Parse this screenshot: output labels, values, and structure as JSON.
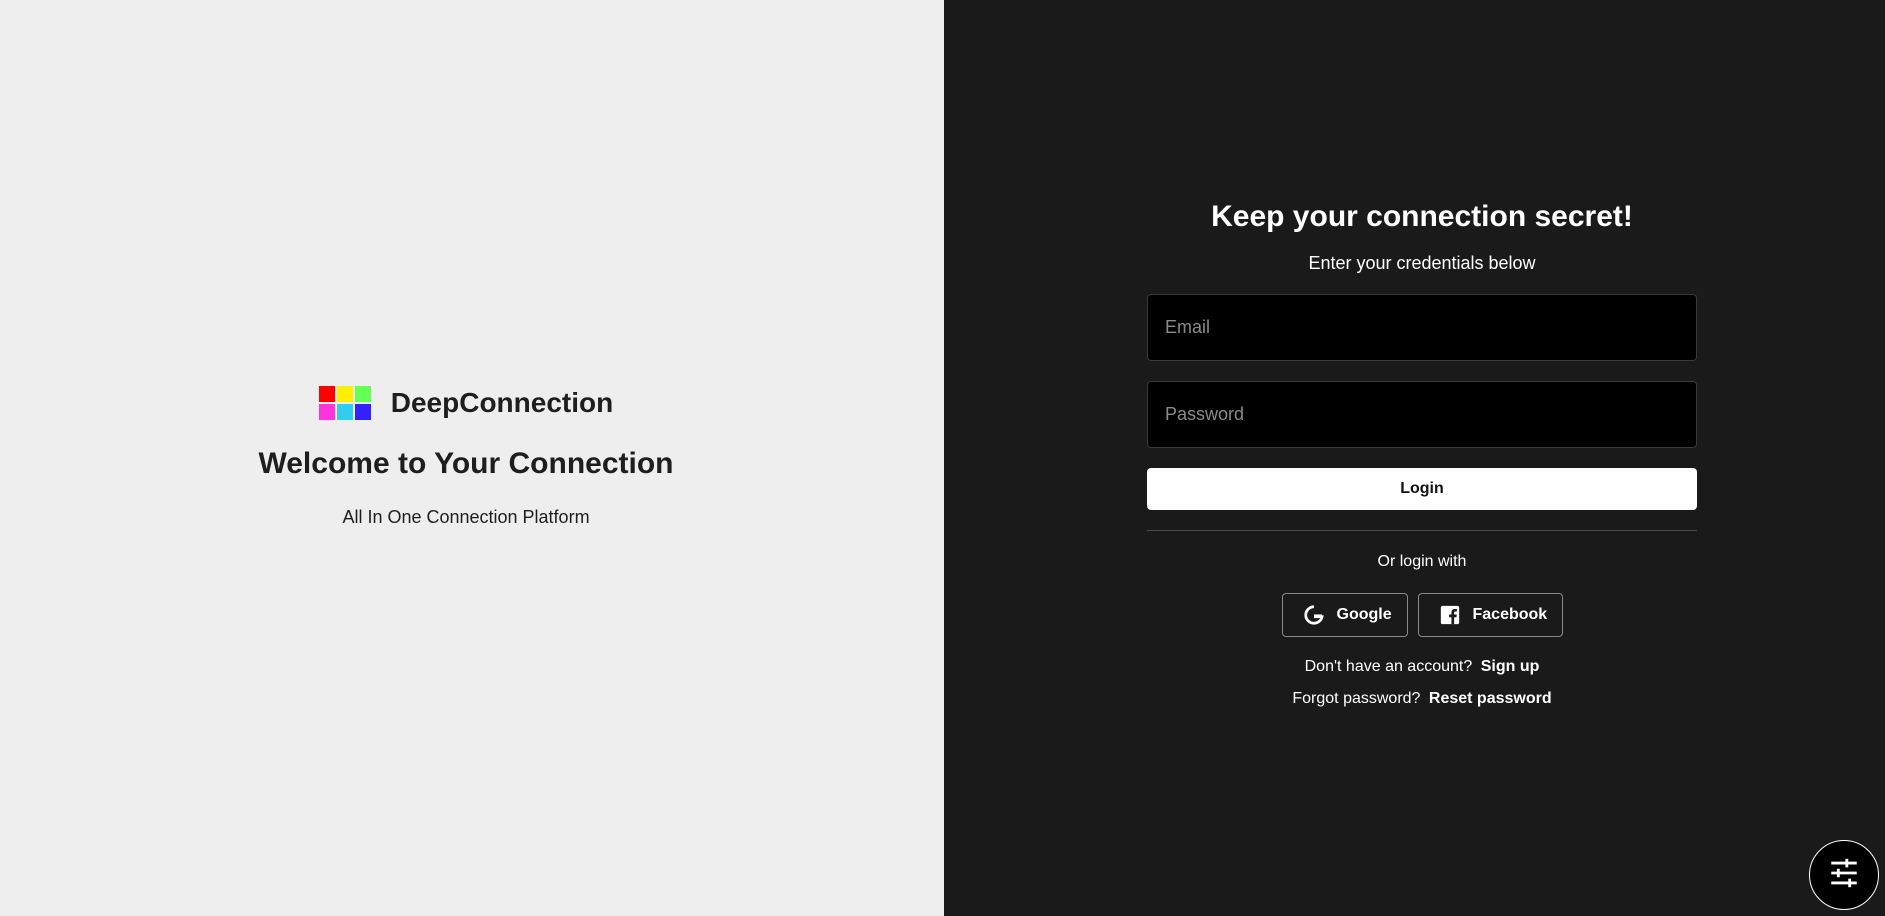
{
  "brand": {
    "name": "DeepConnection",
    "logo_colors": [
      "#ff0000",
      "#ffee00",
      "#66ff55",
      "#ff33dd",
      "#33ccee",
      "#3322ff"
    ]
  },
  "left": {
    "welcome": "Welcome to Your Connection",
    "tagline": "All In One Connection Platform"
  },
  "form": {
    "headline": "Keep your connection secret!",
    "subline": "Enter your credentials below",
    "email_placeholder": "Email",
    "password_placeholder": "Password",
    "login_label": "Login",
    "or_text": "Or login with",
    "google_label": "Google",
    "facebook_label": "Facebook",
    "signup_prompt": "Don't have an account?",
    "signup_link": "Sign up",
    "forgot_prompt": "Forgot password?",
    "reset_link": "Reset password"
  },
  "icons": {
    "google": "google-icon",
    "facebook": "facebook-icon",
    "settings": "sliders-icon"
  }
}
